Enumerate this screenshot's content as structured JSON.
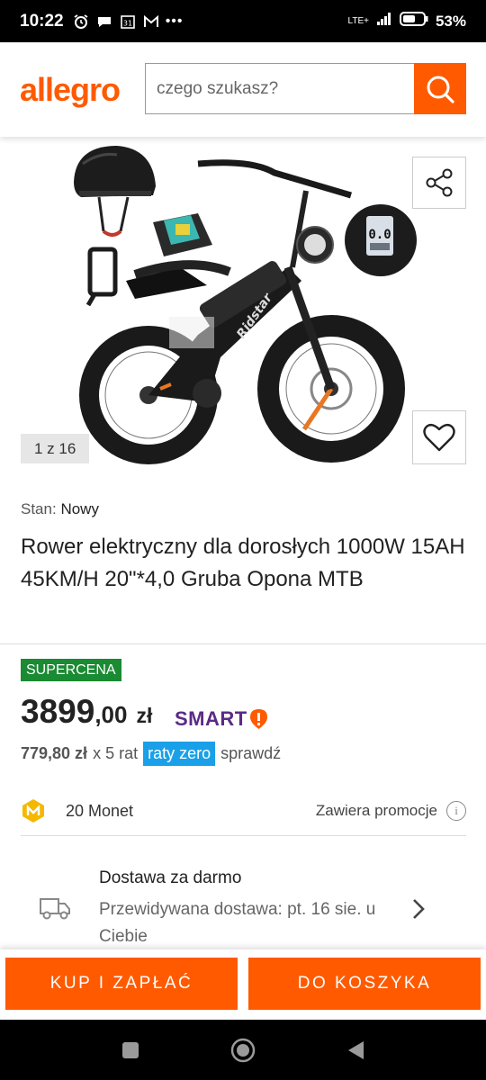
{
  "status_bar": {
    "time": "10:22",
    "network": "LTE+",
    "battery": "53%",
    "calendar_day": "31"
  },
  "header": {
    "logo": "allegro",
    "search_placeholder": "czego szukasz?"
  },
  "gallery": {
    "counter": "1 z 16",
    "image_brand_text": "Ridstar"
  },
  "product": {
    "condition_label": "Stan:",
    "condition_value": "Nowy",
    "title": "Rower elektryczny dla dorosłych 1000W 15AH 45KM/H 20\"*4,0 Gruba Opona MTB",
    "badge": "SUPERCENA",
    "price_int": "3899",
    "price_dec": ",00",
    "currency": "zł",
    "smart_label": "SMART",
    "installment_amount": "779,80 zł",
    "installment_count": "x 5 rat",
    "raty_badge": "raty zero",
    "check_link": "sprawdź"
  },
  "coins": {
    "label": "20 Monet",
    "promo": "Zawiera promocje"
  },
  "delivery": {
    "title": "Dostawa za darmo",
    "date": "Przewidywana dostawa: pt. 16 sie. u Ciebie"
  },
  "actions": {
    "buy": "KUP I ZAPŁAĆ",
    "cart": "DO KOSZYKA"
  },
  "colors": {
    "accent": "#ff5a00",
    "supercena": "#1a8a33",
    "raty": "#1aa0e8",
    "smart": "#5b2a86"
  }
}
